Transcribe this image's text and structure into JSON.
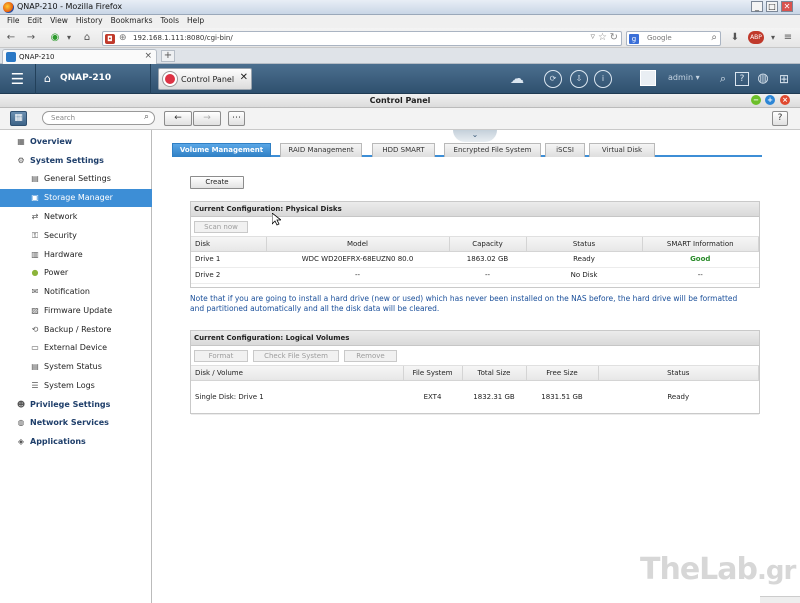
{
  "window": {
    "title": "QNAP-210 - Mozilla Firefox",
    "minimize": "_",
    "maximize": "□",
    "close": "✕"
  },
  "menu": [
    "File",
    "Edit",
    "View",
    "History",
    "Bookmarks",
    "Tools",
    "Help"
  ],
  "browser": {
    "url": "192.168.1.111:8080/cgi-bin/",
    "search_placeholder": "Google",
    "tab_title": "QNAP-210",
    "new_tab": "+"
  },
  "qnap": {
    "home_label": "QNAP-210",
    "app_tab": "Control Panel",
    "user": "admin",
    "panel_title": "Control Panel",
    "search_placeholder": "Search"
  },
  "sidebar": {
    "items": [
      {
        "label": "Overview",
        "icon": "overview-icon",
        "top": true
      },
      {
        "label": "System Settings",
        "icon": "gear-icon",
        "top": true
      },
      {
        "label": "General Settings",
        "icon": "settings-icon"
      },
      {
        "label": "Storage Manager",
        "icon": "storage-icon",
        "selected": true
      },
      {
        "label": "Network",
        "icon": "network-icon"
      },
      {
        "label": "Security",
        "icon": "lock-icon"
      },
      {
        "label": "Hardware",
        "icon": "hardware-icon"
      },
      {
        "label": "Power",
        "icon": "lightbulb-icon"
      },
      {
        "label": "Notification",
        "icon": "notification-icon"
      },
      {
        "label": "Firmware Update",
        "icon": "firmware-icon"
      },
      {
        "label": "Backup / Restore",
        "icon": "backup-icon"
      },
      {
        "label": "External Device",
        "icon": "external-device-icon"
      },
      {
        "label": "System Status",
        "icon": "status-icon"
      },
      {
        "label": "System Logs",
        "icon": "logs-icon"
      },
      {
        "label": "Privilege Settings",
        "icon": "user-icon",
        "top": true
      },
      {
        "label": "Network Services",
        "icon": "globe-icon",
        "top": true
      },
      {
        "label": "Applications",
        "icon": "apps-icon",
        "top": true
      }
    ]
  },
  "tabs": [
    "Volume Management",
    "RAID Management",
    "HDD SMART",
    "Encrypted File System",
    "iSCSI",
    "Virtual Disk"
  ],
  "create_label": "Create",
  "physical": {
    "title": "Current Configuration: Physical Disks",
    "scan_label": "Scan now",
    "columns": [
      "Disk",
      "Model",
      "Capacity",
      "Status",
      "SMART Information"
    ],
    "rows": [
      [
        "Drive 1",
        "WDC WD20EFRX-68EUZN0 80.0",
        "1863.02 GB",
        "Ready",
        "Good"
      ],
      [
        "Drive 2",
        "--",
        "--",
        "No Disk",
        "--"
      ]
    ]
  },
  "note": "Note that if you are going to install a hard drive (new or used) which has never been installed on the NAS before, the hard drive will be formatted and partitioned automatically and all the disk data will be cleared.",
  "logical": {
    "title": "Current Configuration: Logical Volumes",
    "buttons": [
      "Format",
      "Check File System",
      "Remove"
    ],
    "columns": [
      "Disk / Volume",
      "File System",
      "Total Size",
      "Free Size",
      "Status"
    ],
    "rows": [
      [
        "Single Disk: Drive 1",
        "EXT4",
        "1832.31 GB",
        "1831.51 GB",
        "Ready"
      ]
    ]
  },
  "watermark": {
    "main": "TheLab",
    "suffix": ".gr"
  }
}
